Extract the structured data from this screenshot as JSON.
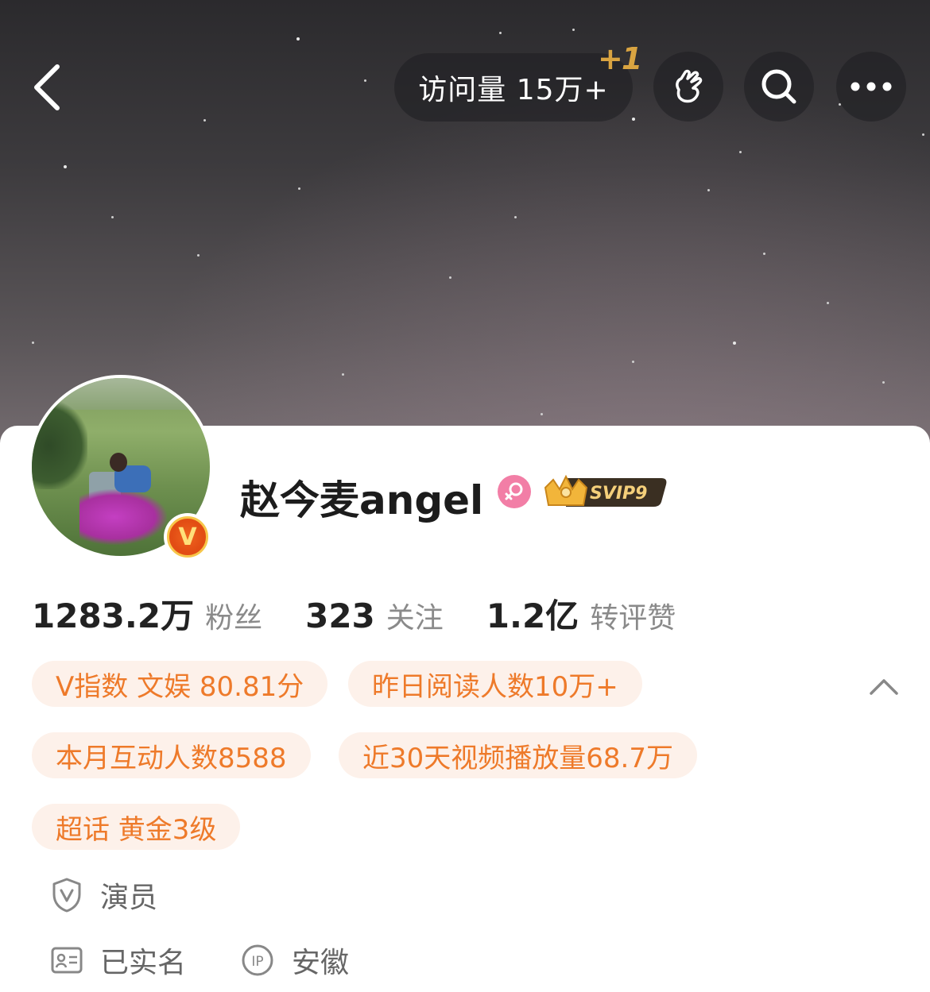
{
  "header": {
    "visits_label": "访问量 15万+",
    "visits_increment": "+1",
    "icons": [
      "back-icon",
      "hand-icon",
      "search-icon",
      "more-icon"
    ]
  },
  "profile": {
    "name": "赵今麦angel",
    "svip_label": "SVIP9",
    "verified_badge": "V"
  },
  "stats": [
    {
      "value": "1283.2万",
      "label": "粉丝"
    },
    {
      "value": "323",
      "label": "关注"
    },
    {
      "value": "1.2亿",
      "label": "转评赞"
    }
  ],
  "tags": [
    "V指数 文娱 80.81分",
    "昨日阅读人数10万+",
    "本月互动人数8588",
    "近30天视频播放量68.7万",
    "超话 黄金3级"
  ],
  "info": {
    "occupation": "演员",
    "real_name_status": "已实名",
    "ip_location": "安徽"
  },
  "colors": {
    "tag_bg": "#fdf1ea",
    "tag_text": "#ee7a2a",
    "accent_gold": "#d9a441"
  }
}
